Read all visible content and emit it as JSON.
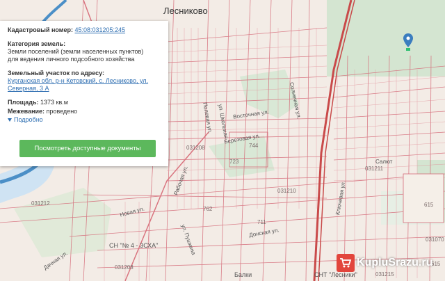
{
  "map": {
    "town_label": "Лесниково",
    "plot_labels": [
      "031208",
      "031211",
      "031210",
      "031212",
      "031208",
      "031215",
      "031070",
      "744",
      "723",
      "762",
      "711",
      "615",
      "615"
    ],
    "street_labels": [
      "Восточная ул.",
      "Березовая ул.",
      "Донская ул.",
      "Ключевая ул.",
      "Солнечная ул.",
      "Полевая ул.",
      "Рабочая ул.",
      "Новая ул.",
      "Дачная ул.",
      "ул. Пушкина",
      "ул. Школьная",
      "Салют"
    ],
    "bottom_labels": [
      "СН \"№ 4 - ЗСХА\"",
      "Балки",
      "СНТ \"Лесники\""
    ],
    "colors": {
      "plot_line": "#d56a78",
      "forest": "#d4e5d1",
      "water": "#4b8fc7",
      "road": "#c94a4a"
    }
  },
  "panel": {
    "cadastral_label": "Кадастровый номер:",
    "cadastral_value": "45:08:031205:245",
    "category_label": "Категория земель:",
    "category_value": "Земли поселений (земли населенных пунктов)",
    "usage_value": "для ведения личного подсобного хозяйства",
    "address_label": "Земельный участок по адресу:",
    "address_value": "Курганская обл, р-н Кетовский, с. Лесниково, ул. Северная, 3 А",
    "area_label": "Площадь:",
    "area_value": "1373 кв.м",
    "survey_label": "Межевание:",
    "survey_value": "проведено",
    "more_label": "Подробно",
    "button_label": "Посмотреть доступные документы"
  },
  "watermark": {
    "text": "KupluSrazu.ru",
    "icon": "cart-icon"
  },
  "marker": {
    "icon": "map-pin-icon"
  }
}
